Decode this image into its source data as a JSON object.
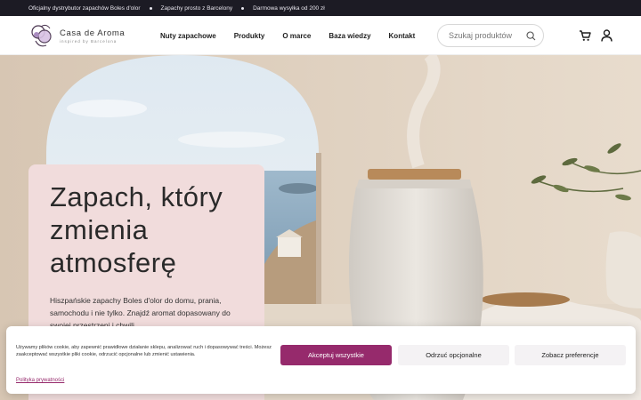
{
  "topbar": {
    "items": [
      "Oficjalny dystrybutor zapachów Boles d'olor",
      "Zapachy prosto z Barcelony",
      "Darmowa wysyłka od 200 zł"
    ]
  },
  "header": {
    "logo_name": "Casa de Aroma",
    "logo_tagline": "inspired by Barcelona",
    "nav": [
      "Nuty zapachowe",
      "Produkty",
      "O marce",
      "Baza wiedzy",
      "Kontakt"
    ],
    "search_placeholder": "Szukaj produktów"
  },
  "hero": {
    "title": "Zapach, który zmienia atmosferę",
    "text": "Hiszpańskie zapachy Boles d'olor do domu, prania, samochodu i nie tylko. Znajdź aromat dopasowany do swojej przestrzeni i chwili."
  },
  "cookie": {
    "text": "Używamy plików cookie, aby zapewnić prawidłowe działanie sklepu, analizować ruch i dopasowywać treści. Możesz zaakceptować wszystkie pliki cookie, odrzucić opcjonalne lub zmienić ustawienia.",
    "accept_label": "Akceptuj wszystkie",
    "reject_label": "Odrzuć opcjonalne",
    "prefs_label": "Zobacz preferencje",
    "privacy_label": "Polityka prywatności"
  },
  "colors": {
    "topbar_bg": "#1c1b24",
    "accent": "#962a6c",
    "hero_card_bg": "#f1dcdc"
  }
}
